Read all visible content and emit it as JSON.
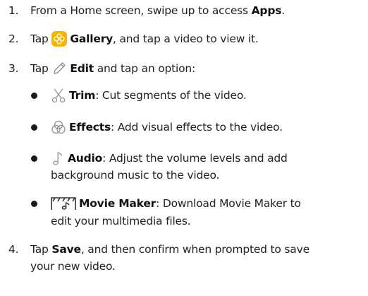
{
  "steps": [
    {
      "number": "1.",
      "before": "From a Home screen, swipe up to access ",
      "bold": "Apps",
      "after": "."
    },
    {
      "number": "2.",
      "before": "Tap ",
      "bold": "Gallery",
      "after": ", and tap a video to view it.",
      "icon": "gallery-icon"
    },
    {
      "number": "3.",
      "before": "Tap ",
      "bold": "Edit",
      "after": " and tap an option:",
      "icon": "pencil-icon"
    },
    {
      "number": "4.",
      "before": "Tap ",
      "bold": "Save",
      "line1_after": ", and then confirm when prompted to save",
      "line2": "your new video."
    }
  ],
  "options": [
    {
      "icon": "scissors-icon",
      "bold": "Trim",
      "text": ": Cut segments of the video."
    },
    {
      "icon": "effects-icon",
      "bold": "Effects",
      "text": ": Add visual effects to the video."
    },
    {
      "icon": "music-note-icon",
      "bold": "Audio",
      "text": ": Adjust the volume levels and add",
      "text_line2": "background music to the video."
    },
    {
      "icon": "movie-maker-icon",
      "bold": "Movie Maker",
      "text": ": Download Movie Maker to",
      "text_line2": "edit your multimedia files."
    }
  ],
  "colors": {
    "text": "#222222",
    "gallery_icon_bg": "#f7b500",
    "icon_stroke": "#9a9a9a",
    "movie_maker_icon": "#333333"
  }
}
